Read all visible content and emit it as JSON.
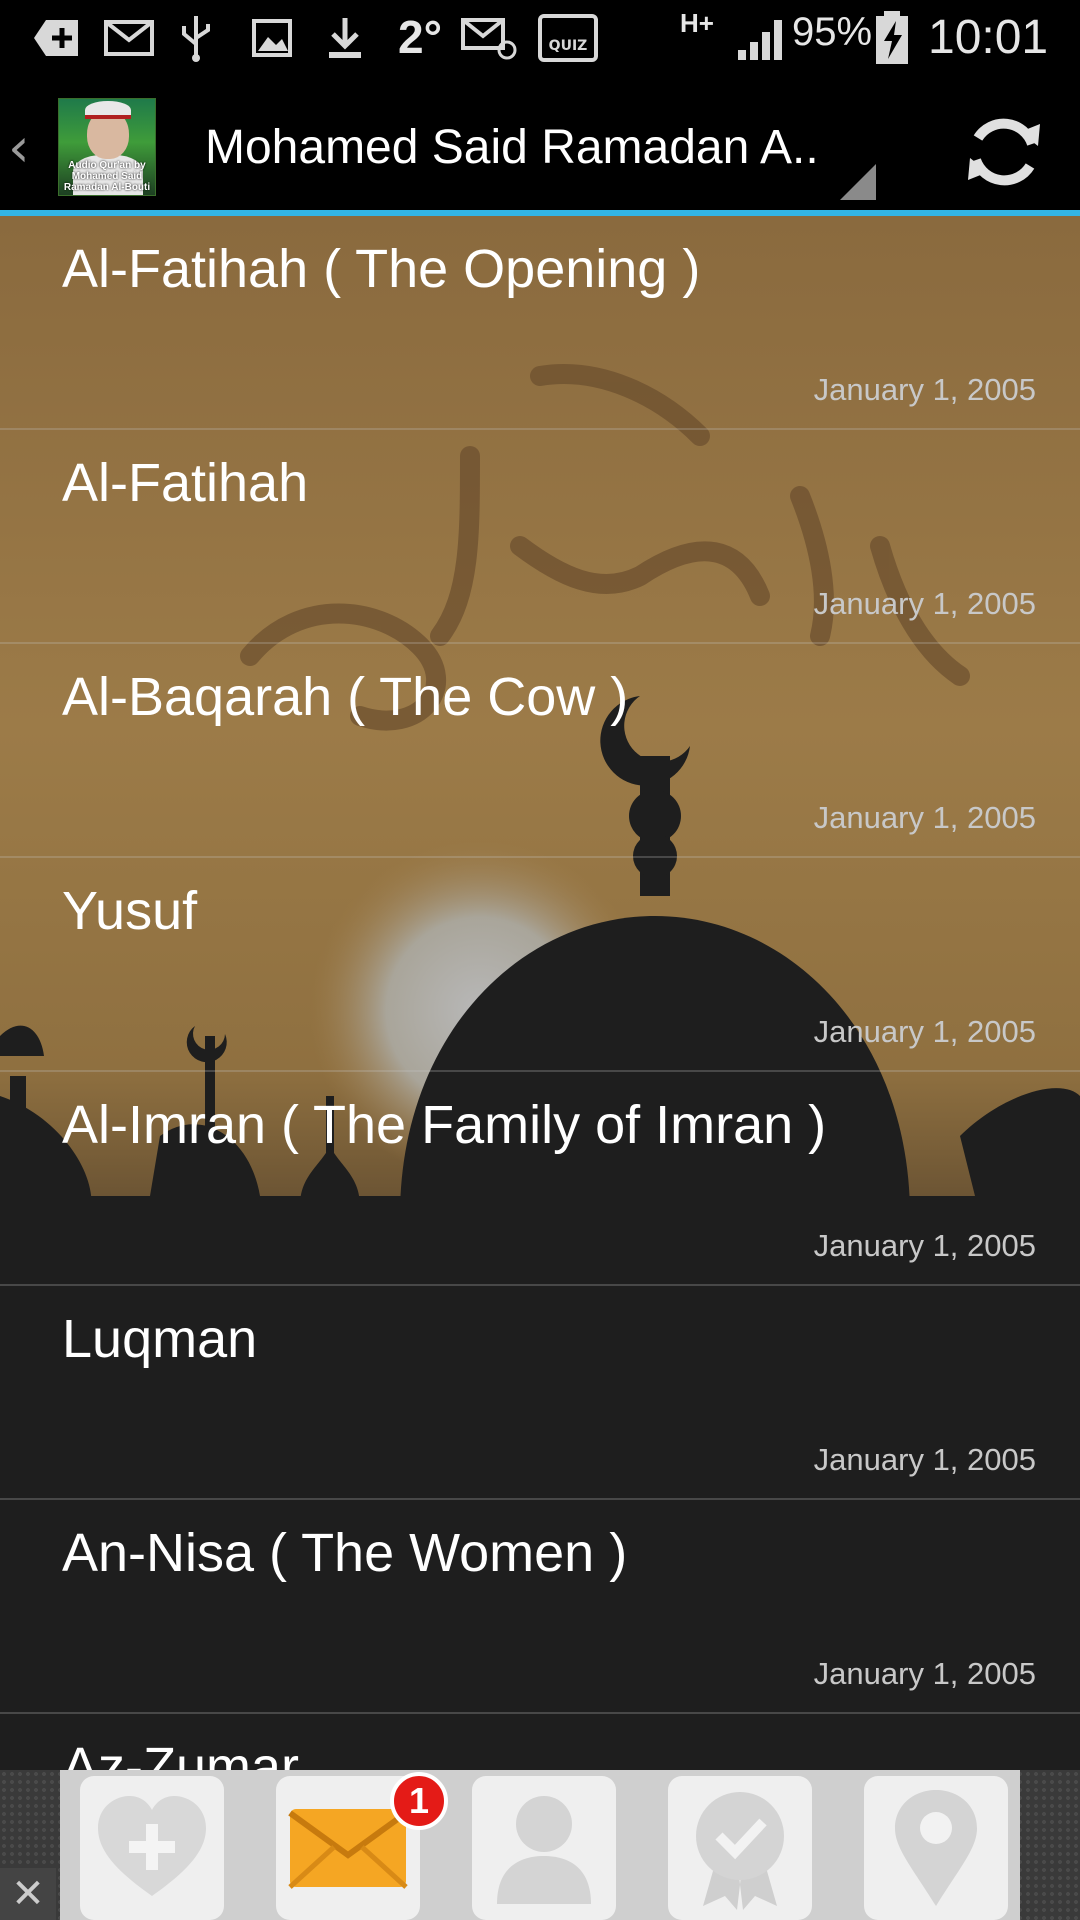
{
  "status_bar": {
    "temperature": "2°",
    "network": "H+",
    "battery": "95%",
    "time": "10:01",
    "quiz_label": "QUIZ",
    "icons": [
      "add-icon",
      "mail-icon",
      "usb-icon",
      "image-icon",
      "download-icon",
      "email-at-icon",
      "quiz-icon",
      "signal-icon",
      "battery-charging-icon"
    ]
  },
  "action_bar": {
    "title": "Mohamed Said Ramadan A..",
    "thumb_caption": "Audio Qur'an by Mohamed Said Ramadan Al-Bouti",
    "refresh_icon": "refresh-icon",
    "accent_color": "#33b5e5"
  },
  "tracks": [
    {
      "title": "Al-Fatihah ( The Opening )",
      "date": "January 1, 2005"
    },
    {
      "title": "Al-Fatihah",
      "date": "January 1, 2005"
    },
    {
      "title": "Al-Baqarah ( The Cow )",
      "date": "January 1, 2005"
    },
    {
      "title": "Yusuf",
      "date": "January 1, 2005"
    },
    {
      "title": "Al-Imran ( The Family of Imran )",
      "date": "January 1, 2005"
    },
    {
      "title": "Luqman",
      "date": "January 1, 2005"
    },
    {
      "title": "An-Nisa ( The Women )",
      "date": "January 1, 2005"
    },
    {
      "title": "Az-Zumar",
      "date": ""
    }
  ],
  "ad_bar": {
    "badge_count": "1",
    "close_label": "✕",
    "tiles": [
      "health-add-icon",
      "mail-icon",
      "person-icon",
      "badge-check-icon",
      "location-pin-icon"
    ]
  }
}
